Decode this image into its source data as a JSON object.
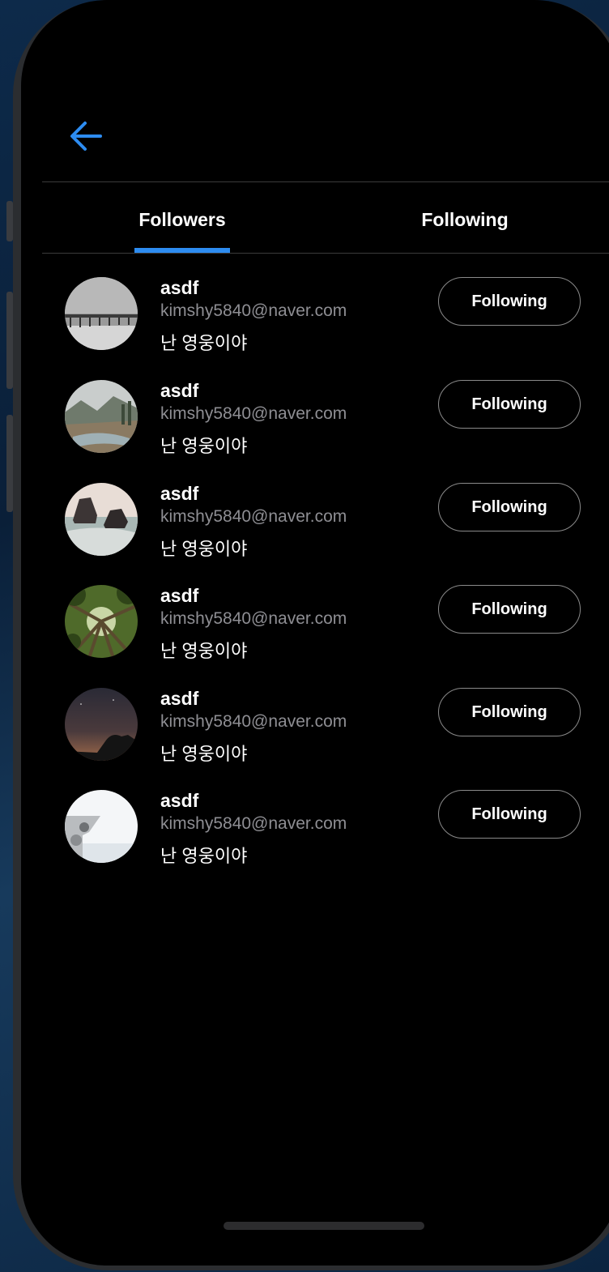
{
  "tabs": {
    "followers_label": "Followers",
    "following_label": "Following",
    "active": "followers"
  },
  "users": [
    {
      "name": "asdf",
      "email": "kimshy5840@naver.com",
      "bio": "난 영웅이야",
      "button_label": "Following",
      "avatar_icon": "pier-photo"
    },
    {
      "name": "asdf",
      "email": "kimshy5840@naver.com",
      "bio": "난 영웅이야",
      "button_label": "Following",
      "avatar_icon": "misty-river-photo"
    },
    {
      "name": "asdf",
      "email": "kimshy5840@naver.com",
      "bio": "난 영웅이야",
      "button_label": "Following",
      "avatar_icon": "sea-rocks-photo"
    },
    {
      "name": "asdf",
      "email": "kimshy5840@naver.com",
      "bio": "난 영웅이야",
      "button_label": "Following",
      "avatar_icon": "forest-canopy-photo"
    },
    {
      "name": "asdf",
      "email": "kimshy5840@naver.com",
      "bio": "난 영웅이야",
      "button_label": "Following",
      "avatar_icon": "night-sky-photo"
    },
    {
      "name": "asdf",
      "email": "kimshy5840@naver.com",
      "bio": "난 영웅이야",
      "button_label": "Following",
      "avatar_icon": "viewer-telescope-photo"
    }
  ],
  "colors": {
    "accent": "#2d8cf0",
    "background": "#000000",
    "secondary_text": "#8e8e93"
  }
}
